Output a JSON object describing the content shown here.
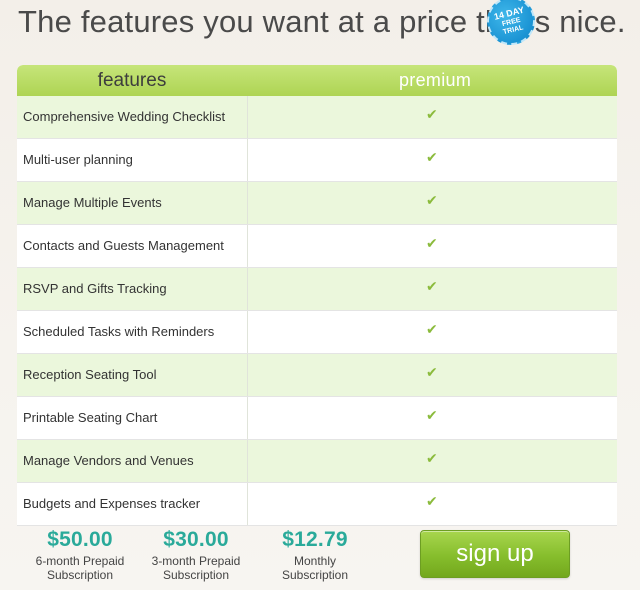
{
  "headline": "The features you want at a price that's nice.",
  "table": {
    "col_features": "features",
    "col_premium": "premium",
    "badge": {
      "line1": "14 DAY",
      "line2": "FREE",
      "line3": "TRIAL"
    },
    "check_mark": "✔",
    "rows": [
      "Comprehensive Wedding Checklist",
      "Multi-user planning",
      "Manage Multiple Events",
      "Contacts and Guests Management",
      "RSVP and Gifts Tracking",
      "Scheduled Tasks with Reminders",
      "Reception Seating Tool",
      "Printable Seating Chart",
      "Manage Vendors and Venues",
      "Budgets and Expenses tracker"
    ]
  },
  "pricing": [
    {
      "amount": "$50.00",
      "line1": "6-month Prepaid",
      "line2": "Subscription"
    },
    {
      "amount": "$30.00",
      "line1": "3-month Prepaid",
      "line2": "Subscription"
    },
    {
      "amount": "$12.79",
      "line1": "Monthly",
      "line2": "Subscription"
    }
  ],
  "signup_label": "sign up",
  "colors": {
    "header_green": "#b7dc62",
    "row_tint": "#ebf7dc",
    "price_teal": "#2aaa9a",
    "button_green": "#86bd2c",
    "badge_blue": "#1b94d4"
  }
}
